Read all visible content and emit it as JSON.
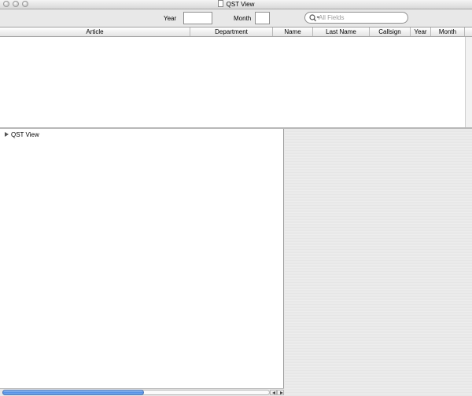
{
  "window": {
    "title": "QST View"
  },
  "toolbar": {
    "year_label": "Year",
    "year_value": "",
    "month_label": "Month",
    "month_value": "",
    "search_placeholder": "All Fields"
  },
  "table": {
    "columns": [
      "Article",
      "Department",
      "Name",
      "Last Name",
      "Callsign",
      "Year",
      "Month"
    ],
    "rows": []
  },
  "outline": {
    "items": [
      {
        "label": "QST View",
        "expanded": false
      }
    ]
  },
  "scroll": {
    "horizontal_position_fraction": 0.53
  }
}
